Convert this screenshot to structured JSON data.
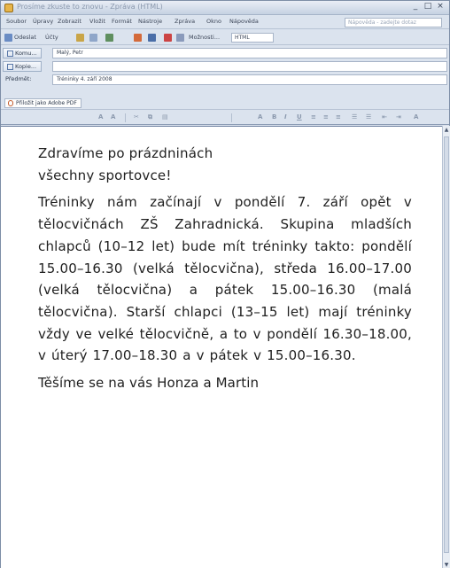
{
  "window": {
    "title": "Prosíme zkuste to znovu - Zpráva (HTML)",
    "controls": [
      "_",
      "□",
      "×"
    ]
  },
  "menu": {
    "items": [
      "Soubor",
      "Úpravy",
      "Zobrazit",
      "Vložit",
      "Formát",
      "Nástroje",
      "Zpráva",
      "Okno",
      "Nápověda"
    ],
    "help_placeholder": "Nápověda - zadejte dotaz"
  },
  "toolbar": {
    "send_label": "Odeslat",
    "accounts_label": "Účty",
    "signature_label": "Možnosti...",
    "format_value": "HTML"
  },
  "fields": {
    "to_label": "Komu...",
    "to_value": "Malý, Petr",
    "cc_label": "Kopie...",
    "cc_value": "",
    "subject_label": "Předmět:",
    "subject_value": "Tréninky 4. září 2008"
  },
  "attachment": {
    "label": "Přiložit jako Adobe PDF"
  },
  "message": {
    "greeting_line1": "Zdravíme po prázdninách",
    "greeting_line2": "všechny sportovce!",
    "body": "Tréninky nám začínají v pondělí 7. září opět v tělocvičnách ZŠ Zahradnická. Skupina mladších chlapců (10–12 let) bude mít tréninky takto: pondělí 15.00–16.30 (velká tělocvična), středa 16.00–17.00 (velká tělocvična) a pátek 15.00–16.30 (malá tělocvična). Starší chlapci (13–15 let) mají tréninky vždy ve velké tělocvičně, a to v pondělí 16.30–18.00, v úterý 17.00–18.30 a v pátek v 15.00–16.30.",
    "signoff": "Těšíme se na vás Honza a Martin"
  },
  "colors": {
    "chrome": "#dbe3ee",
    "body_bg": "#ffffff",
    "text": "#1f1f1f"
  },
  "icons": [
    "app-icon",
    "paperclip-icon",
    "scroll-up-icon",
    "scroll-down-icon"
  ]
}
